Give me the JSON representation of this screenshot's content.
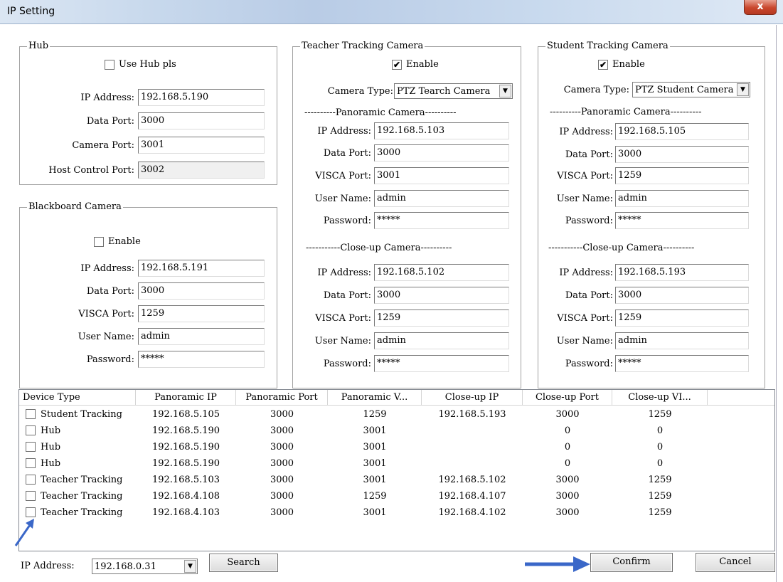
{
  "window": {
    "title": "IP Setting",
    "close_glyph": "x"
  },
  "hub": {
    "title": "Hub",
    "use_hub_label": "Use Hub pls",
    "use_hub_checked": false,
    "ip_label": "IP Address:",
    "ip_value": "192.168.5.190",
    "data_port_label": "Data Port:",
    "data_port_value": "3000",
    "camera_port_label": "Camera Port:",
    "camera_port_value": "3001",
    "host_control_label": "Host Control Port:",
    "host_control_value": "3002"
  },
  "blackboard": {
    "title": "Blackboard Camera",
    "enable_label": "Enable",
    "enable_checked": false,
    "ip_label": "IP Address:",
    "ip_value": "192.168.5.191",
    "data_port_label": "Data Port:",
    "data_port_value": "3000",
    "visca_label": "VISCA Port:",
    "visca_value": "1259",
    "user_label": "User Name:",
    "user_value": "admin",
    "password_label": "Password:",
    "password_value": "*****"
  },
  "teacher": {
    "title": "Teacher Tracking Camera",
    "enable_label": "Enable",
    "enable_checked": true,
    "camera_type_label": "Camera Type:",
    "camera_type_value": "PTZ Tearch Camera",
    "panoramic_sep": "----------Panoramic Camera----------",
    "pano": {
      "ip_label": "IP Address:",
      "ip_value": "192.168.5.103",
      "data_port_label": "Data Port:",
      "data_port_value": "3000",
      "visca_label": "VISCA Port:",
      "visca_value": "3001",
      "user_label": "User Name:",
      "user_value": "admin",
      "password_label": "Password:",
      "password_value": "*****"
    },
    "closeup_sep": "-----------Close-up Camera----------",
    "close": {
      "ip_label": "IP Address:",
      "ip_value": "192.168.5.102",
      "data_port_label": "Data Port:",
      "data_port_value": "3000",
      "visca_label": "VISCA Port:",
      "visca_value": "1259",
      "user_label": "User Name:",
      "user_value": "admin",
      "password_label": "Password:",
      "password_value": "*****"
    }
  },
  "student": {
    "title": "Student Tracking Camera",
    "enable_label": "Enable",
    "enable_checked": true,
    "camera_type_label": "Camera Type:",
    "camera_type_value": "PTZ Student Camera",
    "panoramic_sep": "----------Panoramic Camera----------",
    "pano": {
      "ip_label": "IP Address:",
      "ip_value": "192.168.5.105",
      "data_port_label": "Data Port:",
      "data_port_value": "3000",
      "visca_label": "VISCA Port:",
      "visca_value": "1259",
      "user_label": "User Name:",
      "user_value": "admin",
      "password_label": "Password:",
      "password_value": "*****"
    },
    "closeup_sep": "-----------Close-up Camera----------",
    "close": {
      "ip_label": "IP Address:",
      "ip_value": "192.168.5.193",
      "data_port_label": "Data Port:",
      "data_port_value": "3000",
      "visca_label": "VISCA Port:",
      "visca_value": "1259",
      "user_label": "User Name:",
      "user_value": "admin",
      "password_label": "Password:",
      "password_value": "*****"
    }
  },
  "device_list": {
    "columns": [
      "Device Type",
      "Panoramic IP",
      "Panoramic Port",
      "Panoramic V...",
      "Close-up IP",
      "Close-up Port",
      "Close-up VI..."
    ],
    "rows": [
      [
        "Student Tracking",
        "192.168.5.105",
        "3000",
        "1259",
        "192.168.5.193",
        "3000",
        "1259"
      ],
      [
        "Hub",
        "192.168.5.190",
        "3000",
        "3001",
        "",
        "0",
        "0"
      ],
      [
        "Hub",
        "192.168.5.190",
        "3000",
        "3001",
        "",
        "0",
        "0"
      ],
      [
        "Hub",
        "192.168.5.190",
        "3000",
        "3001",
        "",
        "0",
        "0"
      ],
      [
        "Teacher Tracking",
        "192.168.5.103",
        "3000",
        "3001",
        "192.168.5.102",
        "3000",
        "1259"
      ],
      [
        "Teacher Tracking",
        "192.168.4.108",
        "3000",
        "1259",
        "192.168.4.107",
        "3000",
        "1259"
      ],
      [
        "Teacher Tracking",
        "192.168.4.103",
        "3000",
        "3001",
        "192.168.4.102",
        "3000",
        "1259"
      ]
    ]
  },
  "footer": {
    "ip_label": "IP Address:",
    "ip_value": "192.168.0.31",
    "search_label": "Search",
    "confirm_label": "Confirm",
    "cancel_label": "Cancel"
  },
  "colors": {
    "arrow": "#3a67c8"
  },
  "icons": [
    "close-icon",
    "checkbox-icon",
    "dropdown-arrow-icon",
    "annotation-arrow-icon"
  ]
}
